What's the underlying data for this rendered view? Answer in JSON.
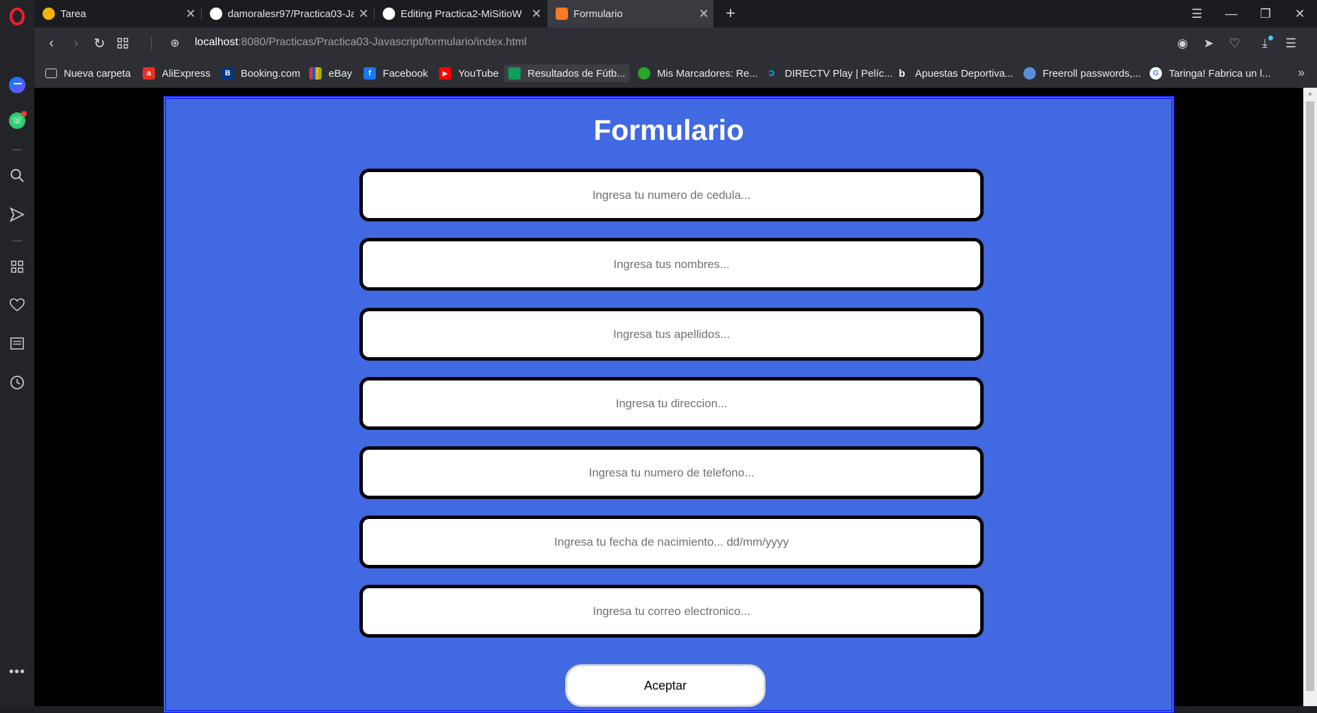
{
  "tabs": [
    {
      "title": "Tarea",
      "active": false,
      "favicon": "classroom-icon",
      "color": "#f4b400"
    },
    {
      "title": "damoralesr97/Practica03-Ja",
      "active": false,
      "favicon": "github-icon",
      "color": "#ffffff"
    },
    {
      "title": "Editing Practica2-MiSitioW",
      "active": false,
      "favicon": "github-icon",
      "color": "#ffffff"
    },
    {
      "title": "Formulario",
      "active": true,
      "favicon": "xampp-icon",
      "color": "#fb7a24"
    }
  ],
  "address": {
    "host": "localhost",
    "path": ":8080/Practicas/Practica03-Javascript/formulario/index.html"
  },
  "bookmarks": [
    {
      "label": "Nueva carpeta",
      "icon": "folder-icon",
      "color": "#2e2f34"
    },
    {
      "label": "AliExpress",
      "icon": "aliexpress-icon",
      "color": "#e43225"
    },
    {
      "label": "Booking.com",
      "icon": "booking-icon",
      "color": "#003580"
    },
    {
      "label": "eBay",
      "icon": "ebay-icon",
      "color": "#2e2f34"
    },
    {
      "label": "Facebook",
      "icon": "facebook-icon",
      "color": "#1877f2"
    },
    {
      "label": "YouTube",
      "icon": "youtube-icon",
      "color": "#ff0000"
    },
    {
      "label": "Resultados de Fútb...",
      "icon": "sheets-icon",
      "color": "#0f9d58"
    },
    {
      "label": "Mis Marcadores: Re...",
      "icon": "marcadores-icon",
      "color": "#2aa52a"
    },
    {
      "label": "DIRECTV Play | Pelíc...",
      "icon": "directv-icon",
      "color": "#00a8e1"
    },
    {
      "label": "Apuestas Deportiva...",
      "icon": "bet-icon",
      "color": "#2e2f34"
    },
    {
      "label": "Freeroll passwords,...",
      "icon": "globe-icon",
      "color": "#5b8dd9"
    },
    {
      "label": "Taringa! Fabrica un l...",
      "icon": "google-icon",
      "color": "#ffffff"
    }
  ],
  "form": {
    "title": "Formulario",
    "fields": [
      {
        "name": "cedula-input",
        "placeholder": "Ingresa tu numero de cedula..."
      },
      {
        "name": "nombres-input",
        "placeholder": "Ingresa tus nombres..."
      },
      {
        "name": "apellidos-input",
        "placeholder": "Ingresa tus apellidos..."
      },
      {
        "name": "direccion-input",
        "placeholder": "Ingresa tu direccion..."
      },
      {
        "name": "telefono-input",
        "placeholder": "Ingresa tu numero de telefono..."
      },
      {
        "name": "fecha-nacimiento-input",
        "placeholder": "Ingresa tu fecha de nacimiento... dd/mm/yyyy"
      },
      {
        "name": "correo-input",
        "placeholder": "Ingresa tu correo electronico..."
      }
    ],
    "submit_label": "Aceptar"
  },
  "colors": {
    "panel": "#4169e1",
    "panel_border": "#0a0aff",
    "opera_red": "#ff1b2d"
  }
}
